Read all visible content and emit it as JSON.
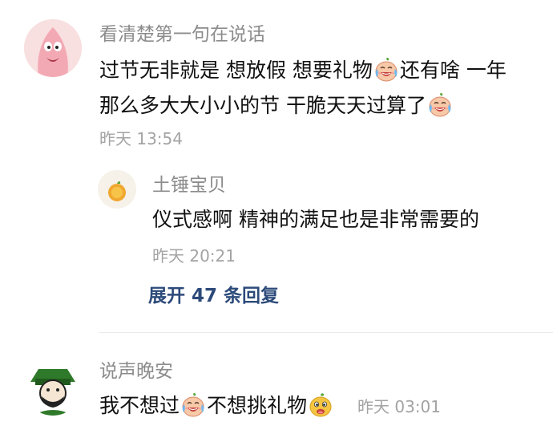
{
  "comments": [
    {
      "username": "看清楚第一句在说话",
      "line1_a": "过节无非就是 想放假 想要礼物",
      "line1_b": "还有啥 一年",
      "line2_a": "那么多大大小小的节 干脆天天过算了",
      "timestamp": "昨天 13:54",
      "reply": {
        "username": "土锤宝贝",
        "text": "仪式感啊 精神的满足也是非常需要的",
        "timestamp": "昨天 20:21"
      },
      "expand_label": "展开 47 条回复"
    },
    {
      "username": "说声晚安",
      "text_a": "我不想过",
      "text_b": "不想挑礼物",
      "timestamp": "昨天 03:01"
    }
  ],
  "icons": {
    "emoji_1": "crying-laughing-face-emoji",
    "emoji_2": "crying-laughing-face-emoji",
    "emoji_3": "crying-laughing-face-emoji",
    "emoji_4": "mischievous-face-emoji"
  }
}
